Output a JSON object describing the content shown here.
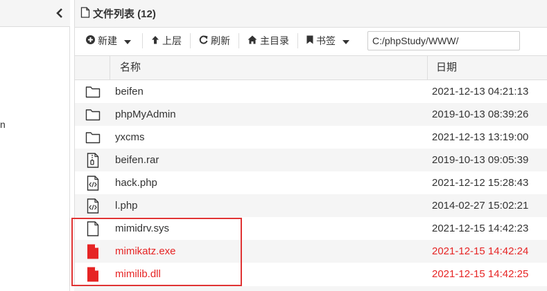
{
  "left_pane": {
    "fragment_text": "n"
  },
  "title": {
    "text": "文件列表 (12)"
  },
  "toolbar": {
    "new_label": "新建",
    "up_label": "上层",
    "refresh_label": "刷新",
    "home_label": "主目录",
    "bookmark_label": "书签",
    "path_value": "C:/phpStudy/WWW/"
  },
  "columns": {
    "name": "名称",
    "date": "日期"
  },
  "files": [
    {
      "name": "beifen",
      "date": "2021-12-13 04:21:13",
      "icon": "folder-icon"
    },
    {
      "name": "phpMyAdmin",
      "date": "2019-10-13 08:39:26",
      "icon": "folder-icon"
    },
    {
      "name": "yxcms",
      "date": "2021-12-13 13:19:00",
      "icon": "folder-icon"
    },
    {
      "name": "beifen.rar",
      "date": "2019-10-13 09:05:39",
      "icon": "archive-file-icon"
    },
    {
      "name": "hack.php",
      "date": "2021-12-12 15:28:43",
      "icon": "code-file-icon"
    },
    {
      "name": "l.php",
      "date": "2014-02-27 15:02:21",
      "icon": "code-file-icon"
    },
    {
      "name": "mimidrv.sys",
      "date": "2021-12-15 14:42:23",
      "icon": "file-icon"
    },
    {
      "name": "mimikatz.exe",
      "date": "2021-12-15 14:42:24",
      "icon": "red-file-icon"
    },
    {
      "name": "mimilib.dll",
      "date": "2021-12-15 14:42:25",
      "icon": "red-file-icon"
    }
  ],
  "colors": {
    "highlight_red": "#e62424",
    "box_red": "#e03333"
  }
}
